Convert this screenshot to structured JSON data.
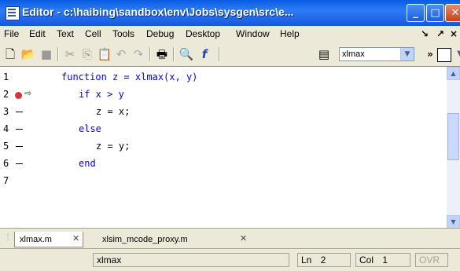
{
  "title": "Editor - c:\\haibing\\sandbox\\env\\Jobs\\sysgen\\src\\e...",
  "window_buttons": {
    "minimize": "_",
    "maximize": "□",
    "close": "✕"
  },
  "menu": [
    "File",
    "Edit",
    "Text",
    "Cell",
    "Tools",
    "Debug",
    "Desktop",
    "Window",
    "Help"
  ],
  "toolbar": {
    "function_combo_value": "xlmax"
  },
  "editor": {
    "line_numbers": [
      "1",
      "2",
      "3",
      "4",
      "5",
      "6",
      "7"
    ],
    "lines": [
      {
        "code": "function z = xlmax(x, y)"
      },
      {
        "code": "if x > y"
      },
      {
        "code": "z = x;"
      },
      {
        "code": "else"
      },
      {
        "code": "z = y;"
      },
      {
        "code": "end"
      },
      {
        "code": ""
      }
    ],
    "breakpoint_line": 2,
    "current_line": 2
  },
  "tabs": [
    {
      "label": "xlmax.m"
    },
    {
      "label": "xlsim_mcode_proxy.m"
    }
  ],
  "status": {
    "function": "xlmax",
    "ln_label": "Ln",
    "ln_value": "2",
    "col_label": "Col",
    "col_value": "1",
    "mode": "OVR"
  }
}
